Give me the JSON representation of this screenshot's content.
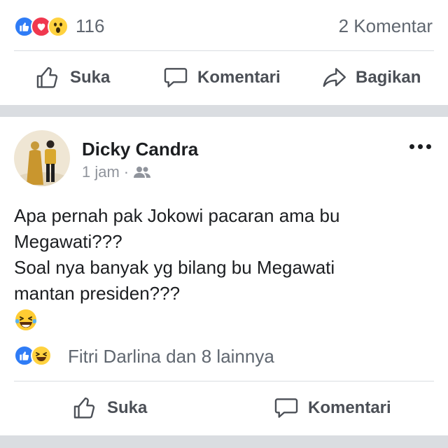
{
  "top_post": {
    "reaction_icons": [
      "like-icon",
      "love-icon",
      "wow-icon"
    ],
    "reaction_count": "116",
    "comment_count_label": "2 Komentar",
    "actions": {
      "like_label": "Suka",
      "comment_label": "Komentari",
      "share_label": "Bagikan"
    }
  },
  "post": {
    "author": "Dicky Candra",
    "time": "1 jam",
    "separator": "·",
    "audience_icon": "friends-icon",
    "more_icon": "more-dots-icon",
    "text_lines": [
      "Apa pernah pak Jokowi pacaran ama bu",
      "Megawati???",
      "Soal nya banyak yg bilang bu Megawati",
      "mantan presiden???"
    ],
    "emoji": "laughing-tears-emoji",
    "reaction_icons": [
      "like-icon",
      "haha-icon"
    ],
    "reactions_label": "Fitri Darlina dan 8 lainnya",
    "actions": {
      "like_label": "Suka",
      "comment_label": "Komentari"
    }
  },
  "colors": {
    "like_blue": "#2f7cf6",
    "love_red": "#f0384f",
    "reaction_yellow": "#ffd23f",
    "separator_gray": "#dadde1",
    "secondary_text": "#606770"
  }
}
